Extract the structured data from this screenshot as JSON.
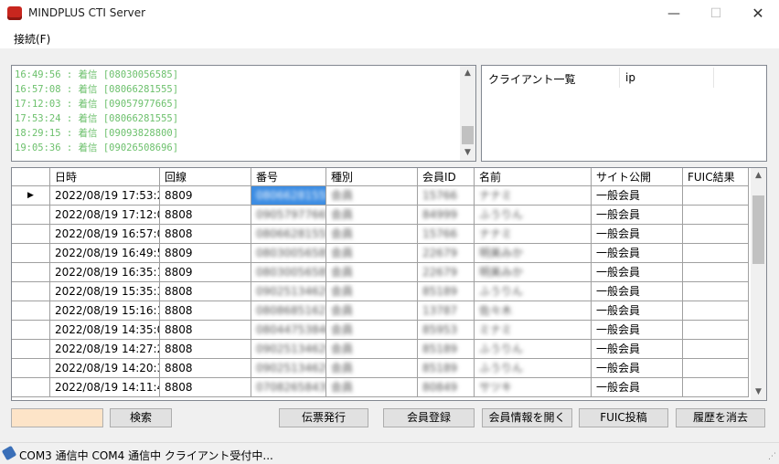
{
  "window": {
    "title": "MINDPLUS CTI Server"
  },
  "menu": {
    "connect": "接続(F)"
  },
  "log": [
    "16:49:56 : 着信 [08030056585]",
    "16:57:08 : 着信 [08066281555]",
    "17:12:03 : 着信 [09057977665]",
    "17:53:24 : 着信 [08066281555]",
    "18:29:15 : 着信 [09093828800]",
    "19:05:36 : 着信 [09026508696]"
  ],
  "clients": {
    "col_list": "クライアント一覧",
    "col_ip": "ip"
  },
  "grid": {
    "columns": [
      "日時",
      "回線",
      "番号",
      "種別",
      "会員ID",
      "名前",
      "サイト公開",
      "FUIC結果"
    ],
    "rows": [
      {
        "datetime": "2022/08/19 17:53:24",
        "line": "8809",
        "number": "08066281555",
        "kind": "会員",
        "member_id": "15766",
        "name": "ナナミ",
        "public": "一般会員",
        "fuic": ""
      },
      {
        "datetime": "2022/08/19 17:12:03",
        "line": "8808",
        "number": "09057977665",
        "kind": "会員",
        "member_id": "84999",
        "name": "ふうりん",
        "public": "一般会員",
        "fuic": ""
      },
      {
        "datetime": "2022/08/19 16:57:08",
        "line": "8808",
        "number": "08066281555",
        "kind": "会員",
        "member_id": "15766",
        "name": "ナナミ",
        "public": "一般会員",
        "fuic": ""
      },
      {
        "datetime": "2022/08/19 16:49:56",
        "line": "8809",
        "number": "08030056585",
        "kind": "会員",
        "member_id": "22679",
        "name": "明美みか",
        "public": "一般会員",
        "fuic": ""
      },
      {
        "datetime": "2022/08/19 16:35:18",
        "line": "8809",
        "number": "08030056585",
        "kind": "会員",
        "member_id": "22679",
        "name": "明美みか",
        "public": "一般会員",
        "fuic": ""
      },
      {
        "datetime": "2022/08/19 15:35:33",
        "line": "8808",
        "number": "09025134629",
        "kind": "会員",
        "member_id": "85189",
        "name": "ふうりん",
        "public": "一般会員",
        "fuic": ""
      },
      {
        "datetime": "2022/08/19 15:16:19",
        "line": "8808",
        "number": "08086851627",
        "kind": "会員",
        "member_id": "13787",
        "name": "佐々木",
        "public": "一般会員",
        "fuic": ""
      },
      {
        "datetime": "2022/08/19 14:35:08",
        "line": "8808",
        "number": "08044753846",
        "kind": "会員",
        "member_id": "85953",
        "name": "ミナミ",
        "public": "一般会員",
        "fuic": ""
      },
      {
        "datetime": "2022/08/19 14:27:29",
        "line": "8808",
        "number": "09025134629",
        "kind": "会員",
        "member_id": "85189",
        "name": "ふうりん",
        "public": "一般会員",
        "fuic": ""
      },
      {
        "datetime": "2022/08/19 14:20:31",
        "line": "8808",
        "number": "09025134629",
        "kind": "会員",
        "member_id": "85189",
        "name": "ふうりん",
        "public": "一般会員",
        "fuic": ""
      },
      {
        "datetime": "2022/08/19 14:11:41",
        "line": "8808",
        "number": "07082658435",
        "kind": "会員",
        "member_id": "80849",
        "name": "サツキ",
        "public": "一般会員",
        "fuic": ""
      }
    ]
  },
  "buttons": {
    "search": "検索",
    "slip": "伝票発行",
    "register": "会員登録",
    "open_member": "会員情報を開く",
    "fuic_post": "FUIC投稿",
    "clear_history": "履歴を消去"
  },
  "status": {
    "text": "COM3 通信中 COM4 通信中 クライアント受付中..."
  },
  "colors": {
    "log_text": "#6cc06c",
    "selection": "#3d8de3",
    "search_field_bg": "#fde4c8"
  }
}
